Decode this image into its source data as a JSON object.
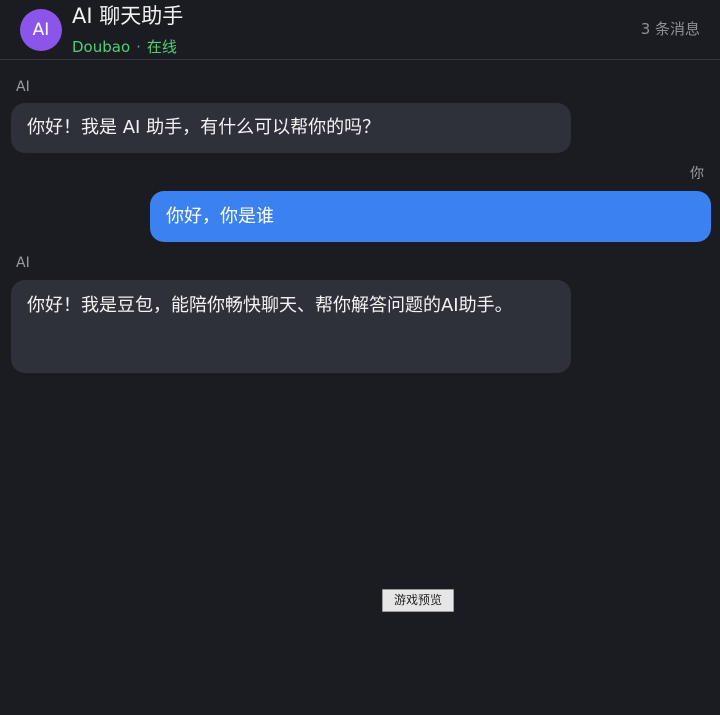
{
  "header": {
    "avatar_text": "AI",
    "title": "AI 聊天助手",
    "model_name": "Doubao",
    "separator": "·",
    "status": "在线",
    "message_count": "3 条消息"
  },
  "messages": [
    {
      "sender": "AI",
      "role": "ai",
      "text": "你好！我是 AI 助手，有什么可以帮你的吗？"
    },
    {
      "sender": "你",
      "role": "user",
      "text": "你好，你是谁"
    },
    {
      "sender": "AI",
      "role": "ai",
      "text": "你好！我是豆包，能陪你畅快聊天、帮你解答问题的AI助手。"
    }
  ],
  "preview_button": {
    "label": "游戏预览"
  },
  "colors": {
    "background": "#1b1c22",
    "ai_bubble": "#2f313a",
    "user_bubble": "#3b82f0",
    "avatar": "#8a55e8",
    "online_status": "#4fcf75"
  }
}
